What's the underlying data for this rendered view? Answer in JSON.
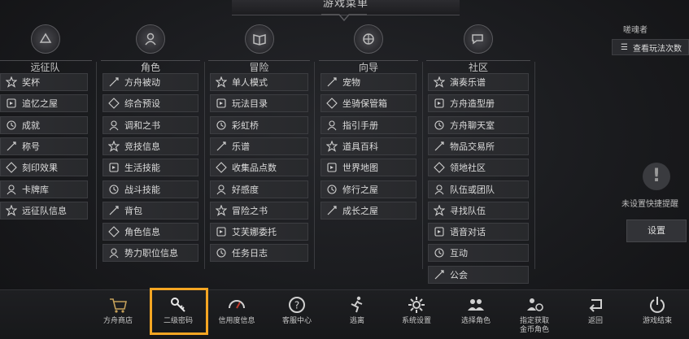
{
  "header": {
    "title": "游戏菜单"
  },
  "columns": [
    {
      "title": "远征队",
      "items": [
        "奖杯",
        "追忆之屋",
        "成就",
        "称号",
        "刻印效果",
        "卡牌库",
        "远征队信息"
      ]
    },
    {
      "title": "角色",
      "items": [
        "方舟被动",
        "综合预设",
        "调和之书",
        "竞技信息",
        "生活技能",
        "战斗技能",
        "背包",
        "角色信息",
        "势力职位信息"
      ]
    },
    {
      "title": "冒险",
      "items": [
        "单人模式",
        "玩法目录",
        "彩虹桥",
        "乐谱",
        "收集品点数",
        "好感度",
        "冒险之书",
        "艾芙娜委托",
        "任务日志"
      ]
    },
    {
      "title": "向导",
      "items": [
        "宠物",
        "坐骑保管箱",
        "指引手册",
        "道具百科",
        "世界地图",
        "修行之屋",
        "成长之屋"
      ]
    },
    {
      "title": "社区",
      "items": [
        "演奏乐谱",
        "方舟造型册",
        "方舟聊天室",
        "物品交易所",
        "领地社区",
        "队伍或团队",
        "寻找队伍",
        "语音对话",
        "互动",
        "公会"
      ]
    }
  ],
  "right_panel": {
    "title": "嗟魂者",
    "view_label": "查看玩法次数",
    "no_reminder": "未设置快捷提醒",
    "settings_button": "设置"
  },
  "bottom_bar": [
    {
      "label": "方舟商店",
      "icon": "cart-icon"
    },
    {
      "label": "二级密码",
      "icon": "key-icon"
    },
    {
      "label": "信用度信息",
      "icon": "gauge-icon"
    },
    {
      "label": "客服中心",
      "icon": "help-icon"
    },
    {
      "label": "逃离",
      "icon": "run-icon"
    },
    {
      "label": "系统设置",
      "icon": "gear-icon"
    },
    {
      "label": "选择角色",
      "icon": "people-icon"
    },
    {
      "label": "指定获取\n金币角色",
      "icon": "gold-person-icon"
    },
    {
      "label": "返回",
      "icon": "return-icon"
    },
    {
      "label": "游戏结束",
      "icon": "power-icon"
    }
  ],
  "colors": {
    "highlight": "#f5a623",
    "background": "#1a1b1e"
  }
}
